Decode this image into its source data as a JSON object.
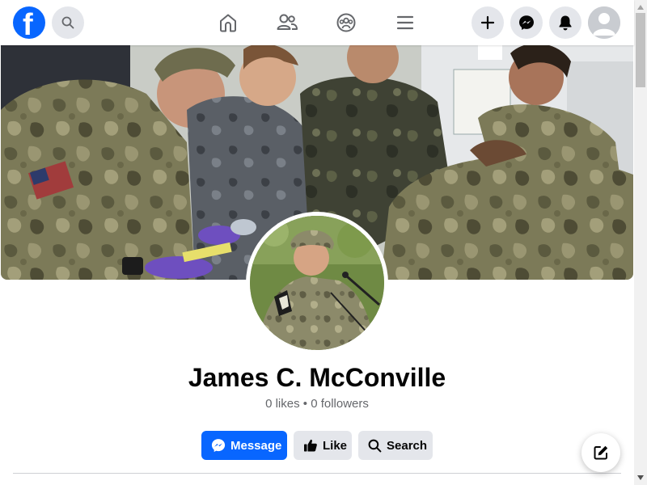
{
  "header": {
    "logo_letter": "f",
    "icons": {
      "search": "search-icon",
      "home": "home-icon",
      "friends": "friends-icon",
      "groups": "groups-icon",
      "menu": "menu-icon",
      "create": "plus-icon",
      "messenger": "messenger-icon",
      "notifications": "bell-icon",
      "account": "avatar"
    }
  },
  "profile": {
    "name": "James C. McConville",
    "stats": "0 likes • 0 followers"
  },
  "actions": {
    "message_label": "Message",
    "like_label": "Like",
    "search_label": "Search"
  },
  "colors": {
    "brand_blue": "#0866ff",
    "secondary_button": "#e4e6eb",
    "text_primary": "#050505",
    "text_secondary": "#65676b"
  }
}
